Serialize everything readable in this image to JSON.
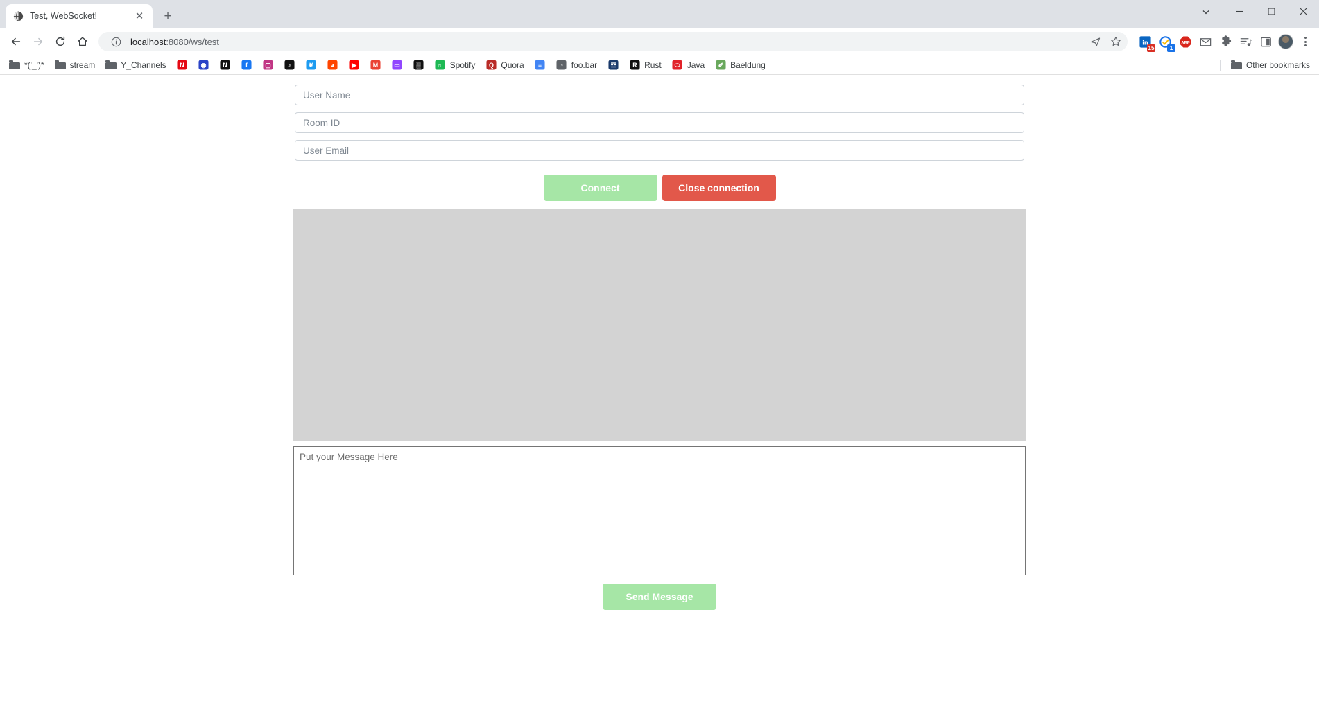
{
  "browser": {
    "tab": {
      "title": "Test, WebSocket!",
      "favicon": "globe-icon",
      "close_label": "✕"
    },
    "new_tab_label": "+",
    "window_controls": {
      "expand": "⌄",
      "minimize": "─",
      "maximize": "□",
      "close": "✕"
    },
    "nav": {
      "back": "←",
      "forward": "→",
      "reload": "⟳",
      "home": "⌂"
    },
    "omnibox": {
      "info_icon": "info-circle-icon",
      "url_host": "localhost",
      "url_path": ":8080/ws/test",
      "share_icon": "➤",
      "bookmark_icon": "☆"
    },
    "extensions": [
      {
        "name": "linkedin-extension",
        "glyph": "in",
        "badge": "15",
        "badge_color": "#d93025",
        "color": "#0a66c2"
      },
      {
        "name": "grammarly-extension",
        "glyph": "✓",
        "badge": "1",
        "badge_color": "#1a73e8",
        "color": "#1a73e8"
      },
      {
        "name": "adblock-plus-extension",
        "glyph": "ABP",
        "badge": "",
        "badge_color": "",
        "color": "#d9261c"
      },
      {
        "name": "mail-extension",
        "glyph": "✉",
        "badge": "",
        "badge_color": "",
        "color": "#5f6368"
      },
      {
        "name": "extensions-puzzle-icon",
        "glyph": "❖",
        "badge": "",
        "badge_color": "",
        "color": "#5f6368"
      },
      {
        "name": "media-playlist-icon",
        "glyph": "≡♪",
        "badge": "",
        "badge_color": "",
        "color": "#5f6368"
      },
      {
        "name": "sidepanel-icon",
        "glyph": "▣",
        "badge": "",
        "badge_color": "",
        "color": "#5f6368"
      }
    ],
    "bookmarks": [
      {
        "label": "*('_')*",
        "icon": "folder-icon",
        "type": "folder"
      },
      {
        "label": "stream",
        "icon": "folder-icon",
        "type": "folder"
      },
      {
        "label": "Y_Channels",
        "icon": "folder-icon",
        "type": "folder"
      },
      {
        "label": "",
        "icon": "netflix-icon",
        "type": "site",
        "glyph": "N",
        "color": "#e50914"
      },
      {
        "label": "",
        "icon": "target-icon",
        "type": "site",
        "glyph": "◉",
        "color": "#2b44c7"
      },
      {
        "label": "",
        "icon": "notion-icon",
        "type": "site",
        "glyph": "N",
        "color": "#111111"
      },
      {
        "label": "",
        "icon": "facebook-icon",
        "type": "site",
        "glyph": "f",
        "color": "#1877f2"
      },
      {
        "label": "",
        "icon": "instagram-icon",
        "type": "site",
        "glyph": "▢",
        "color": "#c13584"
      },
      {
        "label": "",
        "icon": "tiktok-icon",
        "type": "site",
        "glyph": "♪",
        "color": "#111111"
      },
      {
        "label": "",
        "icon": "twitter-icon",
        "type": "site",
        "glyph": "❦",
        "color": "#1d9bf0"
      },
      {
        "label": "",
        "icon": "reddit-icon",
        "type": "site",
        "glyph": "◕",
        "color": "#ff4500"
      },
      {
        "label": "",
        "icon": "youtube-icon",
        "type": "site",
        "glyph": "▶",
        "color": "#ff0000"
      },
      {
        "label": "",
        "icon": "gmail-icon",
        "type": "site",
        "glyph": "M",
        "color": "#ea4335"
      },
      {
        "label": "",
        "icon": "twitch-icon",
        "type": "site",
        "glyph": "▭",
        "color": "#9146ff"
      },
      {
        "label": "",
        "icon": "bench-icon",
        "type": "site",
        "glyph": "▒",
        "color": "#111111"
      },
      {
        "label": "Spotify",
        "icon": "spotify-icon",
        "type": "site",
        "glyph": "♬",
        "color": "#1db954"
      },
      {
        "label": "Quora",
        "icon": "quora-icon",
        "type": "site",
        "glyph": "Q",
        "color": "#b92b27"
      },
      {
        "label": "",
        "icon": "google-docs-icon",
        "type": "site",
        "glyph": "≡",
        "color": "#4285f4"
      },
      {
        "label": "foo.bar",
        "icon": "globe-icon",
        "type": "site",
        "glyph": "◔",
        "color": "#5f6368"
      },
      {
        "label": "",
        "icon": "hackerrank-icon",
        "type": "site",
        "glyph": "☲",
        "color": "#1a3a6b"
      },
      {
        "label": "Rust",
        "icon": "rust-icon",
        "type": "site",
        "glyph": "R",
        "color": "#111111"
      },
      {
        "label": "Java",
        "icon": "java-icon",
        "type": "site",
        "glyph": "⬭",
        "color": "#e12229"
      },
      {
        "label": "Baeldung",
        "icon": "baeldung-icon",
        "type": "site",
        "glyph": "✐",
        "color": "#69a85c"
      }
    ],
    "other_bookmarks": {
      "label": "Other bookmarks",
      "icon": "folder-icon"
    }
  },
  "page": {
    "fields": [
      {
        "name": "user-name-input",
        "placeholder": "User Name",
        "value": ""
      },
      {
        "name": "room-id-input",
        "placeholder": "Room ID",
        "value": ""
      },
      {
        "name": "user-email-input",
        "placeholder": "User Email",
        "value": ""
      }
    ],
    "buttons": {
      "connect": "Connect",
      "close_connection": "Close connection",
      "send_message": "Send Message"
    },
    "message_log": {
      "content": ""
    },
    "message_input": {
      "placeholder": "Put your Message Here",
      "value": ""
    },
    "colors": {
      "connect_bg": "#a6e6a6",
      "close_bg": "#e2584a",
      "log_bg": "#d3d3d3"
    }
  }
}
